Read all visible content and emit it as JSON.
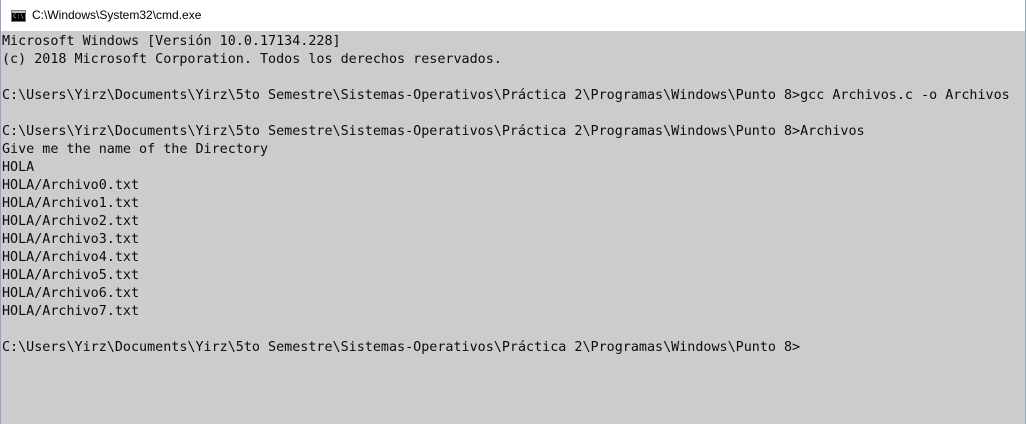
{
  "window": {
    "title": "C:\\Windows\\System32\\cmd.exe",
    "icon": "cmd-console-icon",
    "icon_glyph": "C:\\"
  },
  "console": {
    "background": "#cccccc",
    "text_color": "#0c0c0c",
    "lines": [
      "Microsoft Windows [Versión 10.0.17134.228]",
      "(c) 2018 Microsoft Corporation. Todos los derechos reservados.",
      "",
      "C:\\Users\\Yirz\\Documents\\Yirz\\5to Semestre\\Sistemas-Operativos\\Práctica 2\\Programas\\Windows\\Punto 8>gcc Archivos.c -o Archivos",
      "",
      "C:\\Users\\Yirz\\Documents\\Yirz\\5to Semestre\\Sistemas-Operativos\\Práctica 2\\Programas\\Windows\\Punto 8>Archivos",
      "Give me the name of the Directory",
      "HOLA",
      "HOLA/Archivo0.txt",
      "HOLA/Archivo1.txt",
      "HOLA/Archivo2.txt",
      "HOLA/Archivo3.txt",
      "HOLA/Archivo4.txt",
      "HOLA/Archivo5.txt",
      "HOLA/Archivo6.txt",
      "HOLA/Archivo7.txt",
      "",
      "C:\\Users\\Yirz\\Documents\\Yirz\\5to Semestre\\Sistemas-Operativos\\Práctica 2\\Programas\\Windows\\Punto 8>"
    ]
  }
}
